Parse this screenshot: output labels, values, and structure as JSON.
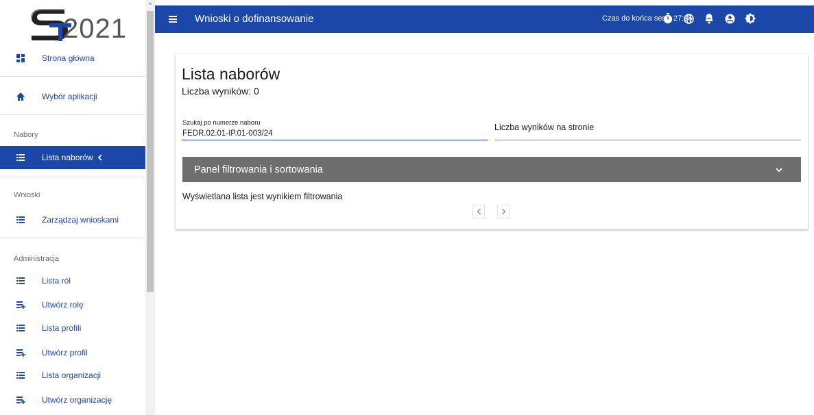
{
  "logo": {
    "text": "2021"
  },
  "sidebar": {
    "items": [
      {
        "label": "Strona główna",
        "icon": "dashboard-icon"
      },
      {
        "label": "Wybór aplikacji",
        "icon": "home-icon"
      },
      {
        "label": "Lista naborów",
        "icon": "list-icon",
        "active": true
      },
      {
        "label": "Zarządzaj wnioskami",
        "icon": "list-icon"
      },
      {
        "label": "Lista ról",
        "icon": "list-icon"
      },
      {
        "label": "Utwórz rolę",
        "icon": "playlist-add-icon"
      },
      {
        "label": "Lista profili",
        "icon": "list-icon"
      },
      {
        "label": "Utwórz profil",
        "icon": "playlist-add-icon"
      },
      {
        "label": "Lista organizacji",
        "icon": "list-icon"
      },
      {
        "label": "Utwórz organizację",
        "icon": "playlist-add-icon"
      }
    ],
    "sections": [
      "Nabory",
      "Wnioski",
      "Administracja"
    ]
  },
  "header": {
    "title": "Wnioski o dofinansowanie",
    "session_label": "Czas do końca sesji: 27:35"
  },
  "main": {
    "title": "Lista naborów",
    "results_count": "Liczba wyników: 0",
    "search": {
      "label": "Szukaj po numerze naboru",
      "value": "FEDR.02.01-IP.01-003/24"
    },
    "per_page_label": "Liczba wyników na stronie",
    "filter_panel_label": "Panel filtrowania i sortowania",
    "filtered_note": "Wyświetlana lista jest wynikiem filtrowania"
  },
  "colors": {
    "primary": "#1a47a8",
    "filter_panel": "#6e6e6e"
  }
}
